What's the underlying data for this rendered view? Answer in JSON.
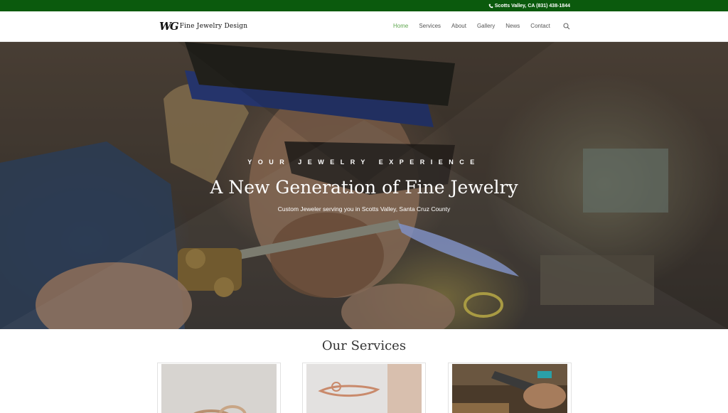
{
  "topbar": {
    "phone_text": "Scotts Valley, CA (831) 438-1844"
  },
  "header": {
    "logo_mark": "WG",
    "logo_text": "Fine Jewelry Design",
    "nav": [
      {
        "label": "Home",
        "active": true
      },
      {
        "label": "Services",
        "active": false
      },
      {
        "label": "About",
        "active": false
      },
      {
        "label": "Gallery",
        "active": false
      },
      {
        "label": "News",
        "active": false
      },
      {
        "label": "Contact",
        "active": false
      }
    ]
  },
  "hero": {
    "kicker": "YOUR JEWELRY EXPERIENCE",
    "headline": "A New Generation of Fine Jewelry",
    "subheadline": "Custom Jeweler serving you in Scotts Valley, Santa Cruz County"
  },
  "services": {
    "title": "Our Services",
    "cards": [
      {
        "image": "rings-photo"
      },
      {
        "image": "rose-gold-ring-photo"
      },
      {
        "image": "jeweler-at-work-photo"
      }
    ]
  },
  "colors": {
    "topbar": "#0b5a0d",
    "nav_active": "#5ea64e",
    "nav_text": "#555555"
  }
}
